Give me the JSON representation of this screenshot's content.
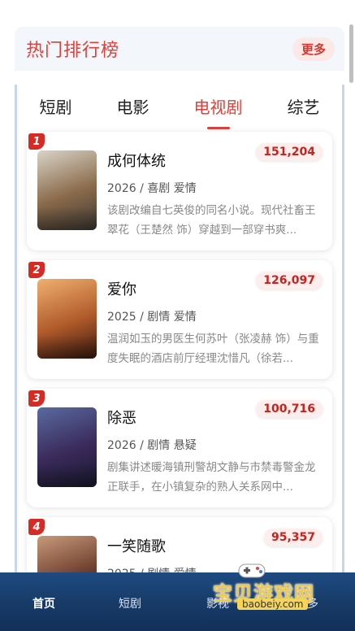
{
  "header": {
    "title": "热门排行榜",
    "more_label": "更多"
  },
  "tabs": [
    {
      "label": "短剧",
      "active": false
    },
    {
      "label": "电影",
      "active": false
    },
    {
      "label": "电视剧",
      "active": true
    },
    {
      "label": "综艺",
      "active": false
    }
  ],
  "items": [
    {
      "rank": "1",
      "title": "成何体统",
      "meta": "2026 / 喜剧 爱情",
      "desc": "该剧改编自七英俊的同名小说。现代社畜王翠花（王楚然 饰）穿越到一部穿书爽...",
      "heat": "151,204",
      "poster_colors": [
        "#d9d4c8",
        "#8a6a4a",
        "#3f3a36"
      ]
    },
    {
      "rank": "2",
      "title": "爱你",
      "meta": "2025 / 剧情 爱情",
      "desc": "温润如玉的男医生何苏叶（张凌赫 饰）与重度失眠的酒店前厅经理沈惜凡（徐若...",
      "heat": "126,097",
      "poster_colors": [
        "#f0b070",
        "#b05a2a",
        "#3a1a10"
      ]
    },
    {
      "rank": "3",
      "title": "除恶",
      "meta": "2026 / 剧情 悬疑",
      "desc": "剧集讲述暖海镇刑警胡文静与市禁毒警金龙正联手，在小镇复杂的熟人关系网中...",
      "heat": "100,716",
      "poster_colors": [
        "#5a6aa0",
        "#3a2a5a",
        "#1a1a30"
      ]
    },
    {
      "rank": "4",
      "title": "一笑随歌",
      "meta": "2025 / 剧情 爱情",
      "desc": "",
      "heat": "95,357",
      "poster_colors": [
        "#c89a7a",
        "#6a3a2a",
        "#2a1a14"
      ]
    }
  ],
  "bottom_nav": [
    {
      "label": "首页",
      "active": true
    },
    {
      "label": "短剧",
      "active": false
    },
    {
      "label": "影视",
      "active": false
    },
    {
      "label": "更多",
      "active": false
    }
  ],
  "watermark": {
    "text": "宝贝游戏网",
    "url": "baobeiy.com"
  }
}
